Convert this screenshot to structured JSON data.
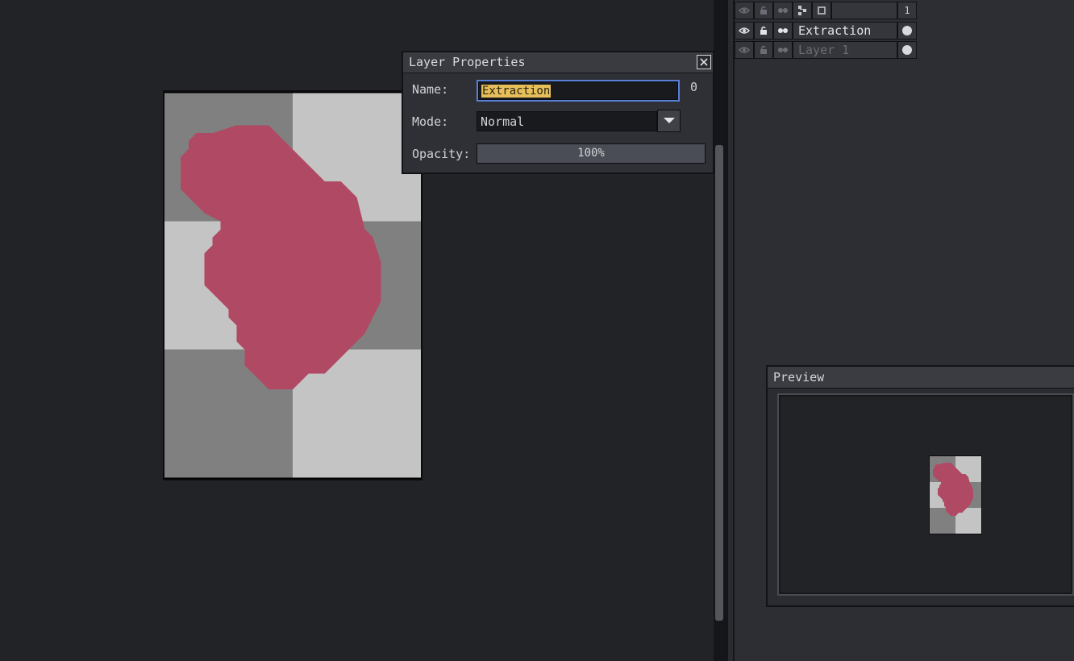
{
  "dialog": {
    "title": "Layer Properties",
    "name_label": "Name:",
    "name_value": "Extraction",
    "name_extra": "0",
    "mode_label": "Mode:",
    "mode_value": "Normal",
    "opacity_label": "Opacity:",
    "opacity_text": "100%",
    "opacity_fraction": 1.0
  },
  "layers": {
    "header": {
      "frame_number": "1"
    },
    "rows": [
      {
        "name": "Extraction",
        "active": true
      },
      {
        "name": "Layer 1",
        "active": false
      }
    ]
  },
  "preview": {
    "title": "Preview"
  },
  "colors": {
    "blob": "#b04a64",
    "checker_dark": "#808080",
    "checker_light": "#c4c4c4",
    "selection_highlight": "#e6bf5a",
    "focus_border": "#5a7fd6"
  },
  "icons": {
    "visibility": "eye-icon",
    "lock": "lock-icon",
    "link": "link-icon",
    "group": "tree-icon",
    "frame": "square-icon",
    "close": "close-icon",
    "dropdown": "chevron-down-icon",
    "cel": "dot-icon"
  }
}
